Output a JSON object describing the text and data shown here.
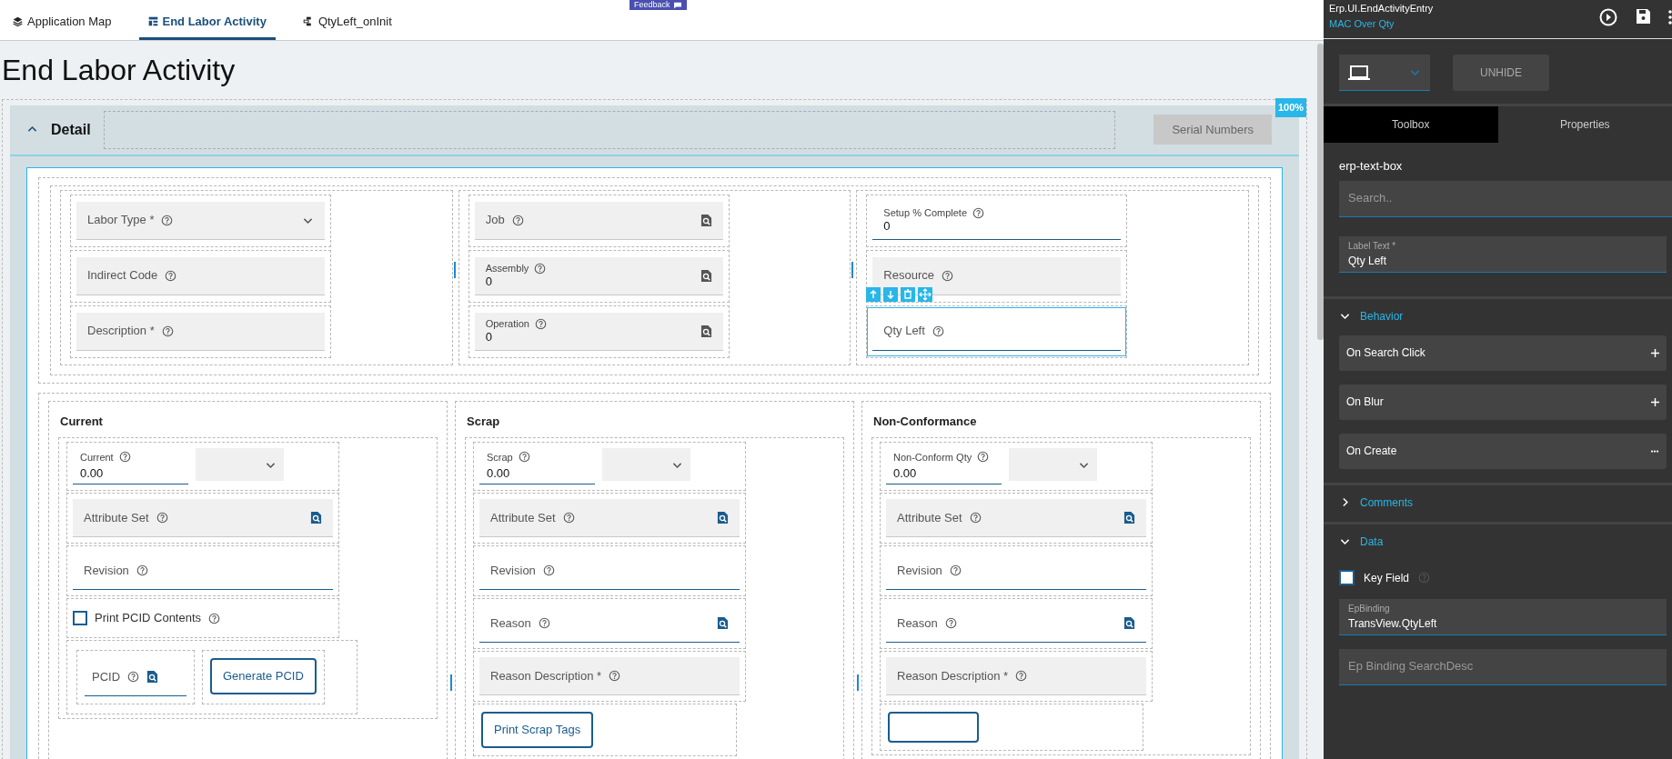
{
  "feedback": "Feedback",
  "tabs": [
    {
      "label": "Application Map",
      "selected": false
    },
    {
      "label": "End Labor Activity",
      "selected": true
    },
    {
      "label": "QtyLeft_onInit",
      "selected": false
    }
  ],
  "page_title": "End Labor Activity",
  "zoom_badge": "100%",
  "detail": {
    "title": "Detail",
    "expanded": true,
    "serial_button": {
      "label": "Serial Numbers",
      "disabled": true
    },
    "top_columns": [
      [
        {
          "kind": "dropdown",
          "label": "Labor Type *",
          "selected": false
        },
        {
          "kind": "text",
          "label": "Indirect Code",
          "selected": false
        },
        {
          "kind": "text",
          "label": "Description *",
          "selected": false
        }
      ],
      [
        {
          "kind": "search",
          "label": "Job",
          "selected": false
        },
        {
          "kind": "search",
          "label": "Assembly",
          "value": "0",
          "selected": false
        },
        {
          "kind": "search",
          "label": "Operation",
          "value": "0",
          "selected": false
        }
      ],
      [
        {
          "kind": "input",
          "label": "Setup % Complete",
          "value": "0",
          "selected": false
        },
        {
          "kind": "text",
          "label": "Resource",
          "selected": false
        },
        {
          "kind": "input",
          "label": "Qty Left",
          "selected": true
        }
      ]
    ],
    "groups": [
      {
        "title": "Current",
        "items": [
          {
            "kind": "qty",
            "label": "Current",
            "value": "0.00"
          },
          {
            "kind": "search",
            "label": "Attribute Set",
            "selected": false
          },
          {
            "kind": "input",
            "label": "Revision",
            "selected": false
          },
          {
            "kind": "checkbox",
            "label": "Print PCID Contents",
            "checked": false
          },
          {
            "kind": "field_button",
            "label": "PCID",
            "button": "Generate PCID"
          }
        ]
      },
      {
        "title": "Scrap",
        "items": [
          {
            "kind": "qty",
            "label": "Scrap",
            "value": "0.00"
          },
          {
            "kind": "search",
            "label": "Attribute Set",
            "selected": false
          },
          {
            "kind": "input",
            "label": "Revision",
            "selected": false
          },
          {
            "kind": "lookup",
            "label": "Reason",
            "selected": false
          },
          {
            "kind": "text",
            "label": "Reason Description *",
            "selected": false
          },
          {
            "kind": "button",
            "label": "Print Scrap Tags"
          }
        ]
      },
      {
        "title": "Non-Conformance",
        "items": [
          {
            "kind": "qty",
            "label": "Non-Conform Qty",
            "value": "0.00"
          },
          {
            "kind": "search",
            "label": "Attribute Set",
            "selected": false
          },
          {
            "kind": "input",
            "label": "Revision",
            "selected": false
          },
          {
            "kind": "lookup",
            "label": "Reason",
            "selected": false
          },
          {
            "kind": "text",
            "label": "Reason Description *",
            "selected": false
          },
          {
            "kind": "button"
          }
        ]
      }
    ]
  },
  "designer": {
    "title": "Erp.UI.EndActivityEntry",
    "subtitle": "MAC Over Qty",
    "unhide": "UNHIDE",
    "panel_tabs": [
      {
        "label": "Toolbox",
        "selected": true
      },
      {
        "label": "Properties",
        "selected": false
      }
    ],
    "component": "erp-text-box",
    "search": {
      "placeholder": "Search.."
    },
    "label_text": {
      "label": "Label Text *",
      "value": "Qty Left"
    },
    "sections": [
      {
        "title": "Behavior",
        "expanded": true,
        "events": [
          {
            "label": "On Search Click",
            "kind": "add"
          },
          {
            "label": "On Blur",
            "kind": "add"
          },
          {
            "label": "On Create",
            "kind": "more"
          }
        ]
      },
      {
        "title": "Comments",
        "expanded": false
      },
      {
        "title": "Data",
        "expanded": true,
        "key_field": {
          "label": "Key Field",
          "checked": false
        },
        "binding": {
          "label": "EpBinding",
          "value": "TransView.QtyLeft"
        },
        "search_desc": {
          "placeholder": "Ep Binding SearchDesc"
        }
      }
    ]
  }
}
